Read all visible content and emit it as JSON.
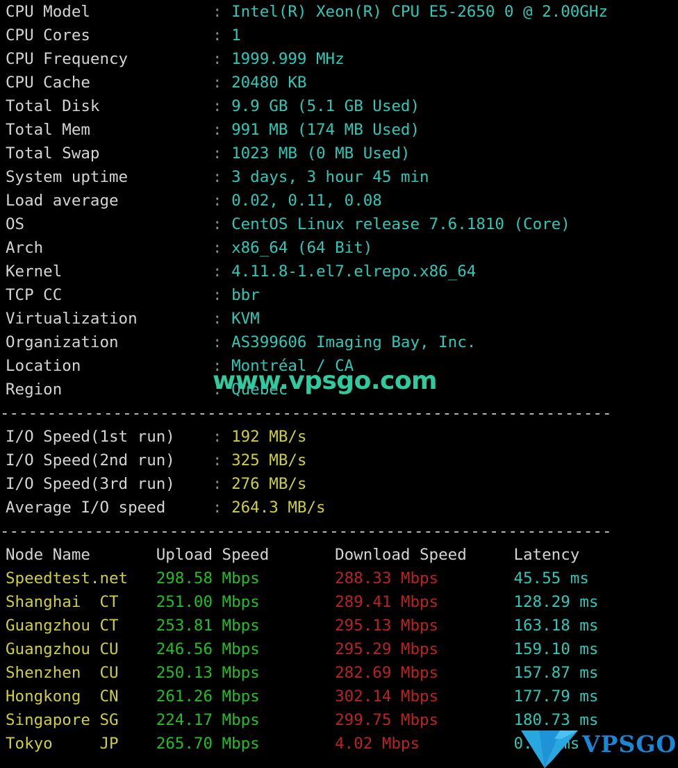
{
  "terminal": {
    "colors": {
      "background": "#000000",
      "label": "#d4d4d4",
      "colon": "#8a8a8a",
      "cyan": "#2ec8b8",
      "yellow": "#cfcf3c",
      "green": "#1fc01f",
      "red": "#bb2222",
      "watermark": "#2ecb9e",
      "logo_blue": "#1787d6",
      "logo_blue_light": "#29a8e0"
    },
    "colon_char": ":",
    "separator": "-----------------------------------------------------------------"
  },
  "system_info": [
    {
      "label": "CPU Model",
      "value": "Intel(R) Xeon(R) CPU E5-2650 0 @ 2.00GHz"
    },
    {
      "label": "CPU Cores",
      "value": "1"
    },
    {
      "label": "CPU Frequency",
      "value": "1999.999 MHz"
    },
    {
      "label": "CPU Cache",
      "value": "20480 KB"
    },
    {
      "label": "Total Disk",
      "value": "9.9 GB (5.1 GB Used)"
    },
    {
      "label": "Total Mem",
      "value": "991 MB (174 MB Used)"
    },
    {
      "label": "Total Swap",
      "value": "1023 MB (0 MB Used)"
    },
    {
      "label": "System uptime",
      "value": "3 days, 3 hour 45 min"
    },
    {
      "label": "Load average",
      "value": "0.02, 0.11, 0.08"
    },
    {
      "label": "OS",
      "value": "CentOS Linux release 7.6.1810 (Core)"
    },
    {
      "label": "Arch",
      "value": "x86_64 (64 Bit)"
    },
    {
      "label": "Kernel",
      "value": "4.11.8-1.el7.elrepo.x86_64"
    },
    {
      "label": "TCP CC",
      "value": "bbr"
    },
    {
      "label": "Virtualization",
      "value": "KVM"
    },
    {
      "label": "Organization",
      "value": "AS399606 Imaging Bay, Inc."
    },
    {
      "label": "Location",
      "value": "Montréal / CA"
    },
    {
      "label": "Region",
      "value": "Quebec"
    }
  ],
  "io_speed": [
    {
      "label": "I/O Speed(1st run)",
      "value": "192 MB/s"
    },
    {
      "label": "I/O Speed(2nd run)",
      "value": "325 MB/s"
    },
    {
      "label": "I/O Speed(3rd run)",
      "value": "276 MB/s"
    },
    {
      "label": "Average I/O speed",
      "value": "264.3 MB/s"
    }
  ],
  "speedtest": {
    "headers": {
      "node": "Node Name",
      "isp": "",
      "upload": "Upload Speed",
      "download": "Download Speed",
      "latency": "Latency"
    },
    "rows": [
      {
        "node": "Speedtest.net",
        "isp": "",
        "upload": "298.58 Mbps",
        "download": "288.33 Mbps",
        "latency": "45.55 ms"
      },
      {
        "node": "Shanghai",
        "isp": "CT",
        "upload": "251.00 Mbps",
        "download": "289.41 Mbps",
        "latency": "128.29 ms"
      },
      {
        "node": "Guangzhou",
        "isp": "CT",
        "upload": "253.81 Mbps",
        "download": "295.13 Mbps",
        "latency": "163.18 ms"
      },
      {
        "node": "Guangzhou",
        "isp": "CU",
        "upload": "246.56 Mbps",
        "download": "295.29 Mbps",
        "latency": "159.10 ms"
      },
      {
        "node": "Shenzhen",
        "isp": "CU",
        "upload": "250.13 Mbps",
        "download": "282.69 Mbps",
        "latency": "157.87 ms"
      },
      {
        "node": "Hongkong",
        "isp": "CN",
        "upload": "261.26 Mbps",
        "download": "302.14 Mbps",
        "latency": "177.79 ms"
      },
      {
        "node": "Singapore",
        "isp": "SG",
        "upload": "224.17 Mbps",
        "download": "299.75 Mbps",
        "latency": "180.73 ms"
      },
      {
        "node": "Tokyo",
        "isp": "JP",
        "upload": "265.70 Mbps",
        "download": "4.02 Mbps",
        "latency": "0.00 ms"
      }
    ]
  },
  "overlays": {
    "watermark_text": "www.vpsgo.com",
    "logo_text": "VPSGO",
    "logo_mark": "v-mark-icon"
  }
}
